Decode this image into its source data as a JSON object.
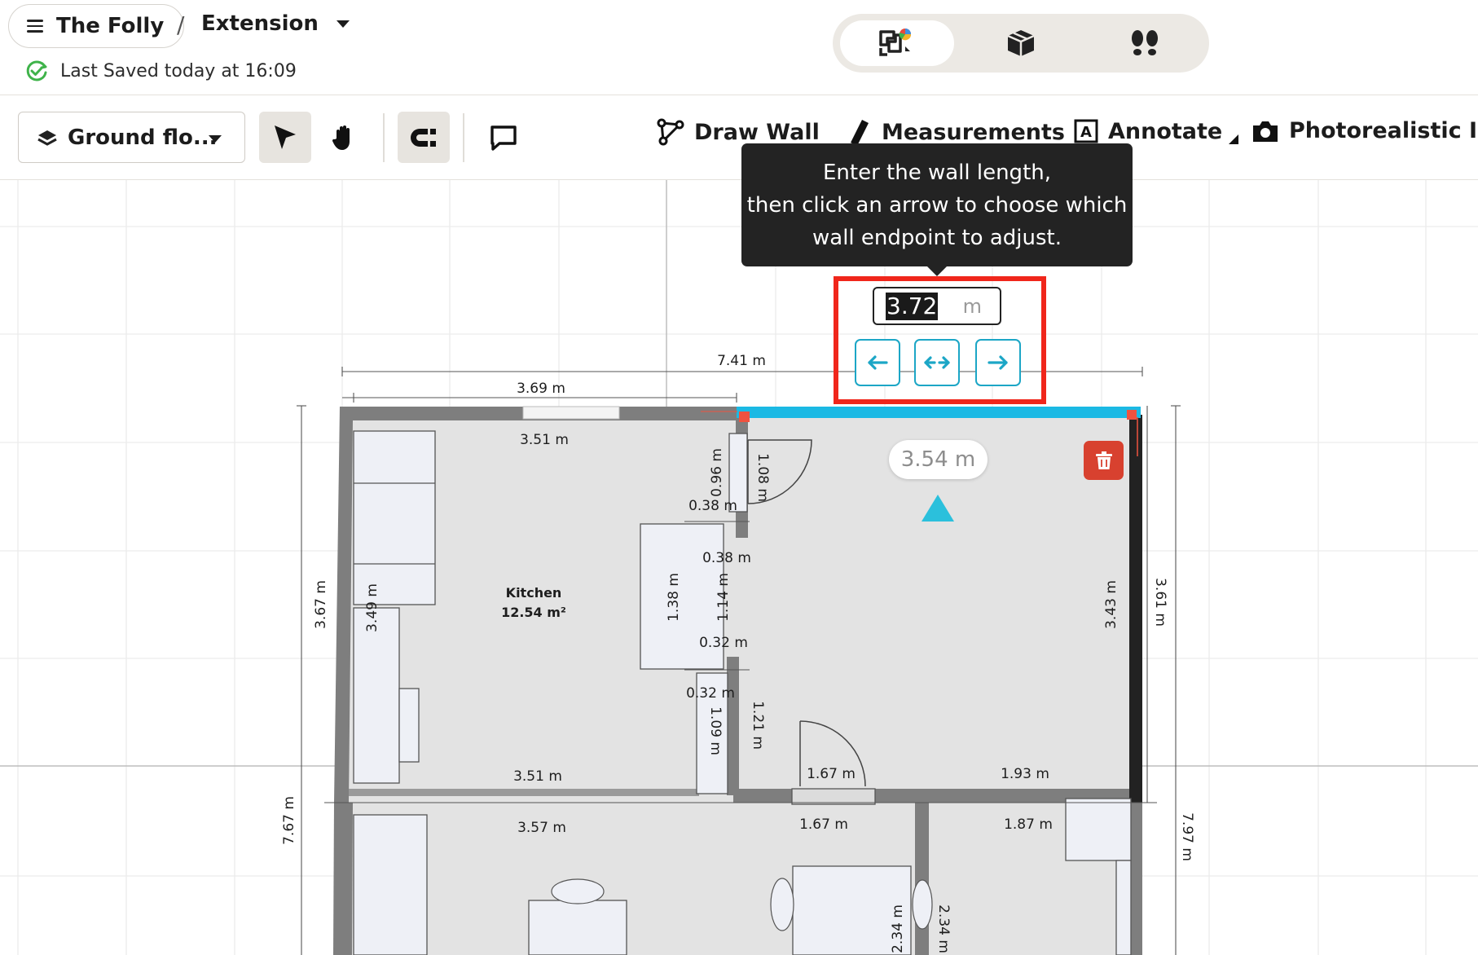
{
  "header": {
    "project_name": "The Folly",
    "separator": "/",
    "design_name": "Extension",
    "saved_status": "Last Saved today at 16:09",
    "view_modes": [
      "2d-plan-icon",
      "3d-cube-icon",
      "walkthrough-footsteps-icon"
    ],
    "active_view": "2d-plan-icon"
  },
  "toolbar": {
    "floor_label": "Ground flo...",
    "tools": {
      "draw_wall": "Draw Wall",
      "measurements": "Measurements",
      "annotate": "Annotate",
      "photorealistic": "Photorealistic Imag"
    }
  },
  "wall_editor": {
    "tooltip_lines": [
      "Enter the wall length,",
      "then click an arrow to choose which",
      "wall endpoint to adjust."
    ],
    "length_value": "3.72",
    "length_unit": "m",
    "inner_length_label": "3.54 m",
    "accent_color": "#1ca6c6",
    "highlight_color": "#f0261b"
  },
  "plan": {
    "room_name": "Kitchen",
    "room_area": "12.54 m²",
    "dimensions": {
      "total_top": "7.41 m",
      "top_left_outer": "3.69 m",
      "top_left_inner": "3.51 m",
      "d_096": "0.96 m",
      "d_108": "1.08 m",
      "d_038a": "0.38 m",
      "d_038b": "0.38 m",
      "d_138": "1.38 m",
      "d_114": "1.14 m",
      "d_032a": "0.32 m",
      "d_032b": "0.32 m",
      "d_109": "1.09 m",
      "d_121": "1.21 m",
      "d_349": "3.49 m",
      "d_367": "3.67 m",
      "d_343": "3.43 m",
      "d_361": "3.61 m",
      "d_351b": "3.51 m",
      "d_167a": "1.67 m",
      "d_193": "1.93 m",
      "d_357": "3.57 m",
      "d_167b": "1.67 m",
      "d_187": "1.87 m",
      "d_767": "7.67 m",
      "d_797": "7.97 m",
      "d_234a": "2.34 m",
      "d_234b": "2.34 m"
    }
  }
}
